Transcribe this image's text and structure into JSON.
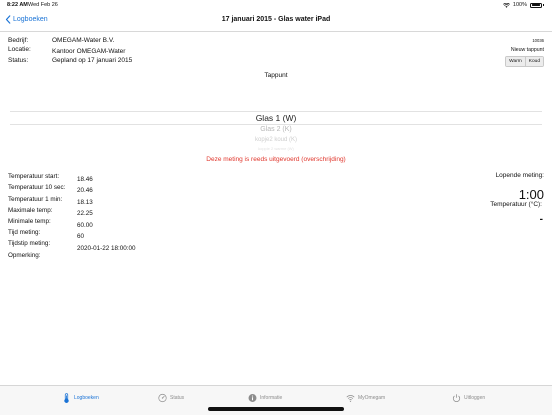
{
  "status_bar": {
    "time": "8:22 AM",
    "date": "Wed Feb 26",
    "battery": "100%"
  },
  "nav": {
    "back_label": "Logboeken",
    "title": "17 januari 2015 - Glas water iPad"
  },
  "info": {
    "rows": [
      {
        "label": "Bedrijf:",
        "value": "OMEGAM-Water B.V."
      },
      {
        "label": "Locatie:",
        "value": "Kantoor OMEGAM-Water"
      },
      {
        "label": "Status:",
        "value": "Gepland op 17 januari 2015"
      }
    ],
    "id_code": "10036",
    "new_tap_label": "Nieuw tappunt",
    "segments": [
      "Warm",
      "Koud"
    ]
  },
  "tappunt_label": "Tappunt",
  "picker": [
    "Glas 1 (W)",
    "Glas 2 (K)",
    "kopje2 koud (K)",
    "koppie 2 warme (W)"
  ],
  "warning": "Deze meting is reeds uitgevoerd (overschrijding)",
  "measurements": [
    {
      "label": "Temperatuur start:",
      "value": "18.46"
    },
    {
      "label": "Temperatuur 10 sec:",
      "value": "20.46"
    },
    {
      "label": "Temperatuur 1 min:",
      "value": "18.13"
    },
    {
      "label": "Maximale temp:",
      "value": "22.25"
    },
    {
      "label": "Minimale temp:",
      "value": "60.00"
    },
    {
      "label": "Tijd meting:",
      "value": "60"
    },
    {
      "label": "Tijdstip meting:",
      "value": "2020-01-22 18:00:00"
    },
    {
      "label": "Opmerking:",
      "value": ""
    }
  ],
  "right_panel": {
    "running_label": "Lopende meting:",
    "timer": "1:00",
    "temp_label": "Temperatuur (°C):",
    "temp_value": "-"
  },
  "tabs": [
    {
      "label": "Logboeken",
      "icon": "thermometer-icon",
      "active": true
    },
    {
      "label": "Status",
      "icon": "gauge-icon",
      "active": false
    },
    {
      "label": "Informatie",
      "icon": "info-icon",
      "active": false
    },
    {
      "label": "MyOmegam",
      "icon": "wifi-icon",
      "active": false
    },
    {
      "label": "Uitloggen",
      "icon": "power-icon",
      "active": false
    }
  ],
  "colors": {
    "accent": "#1a73d6",
    "warning": "#e0352b",
    "inactive": "#8c8c8c"
  }
}
